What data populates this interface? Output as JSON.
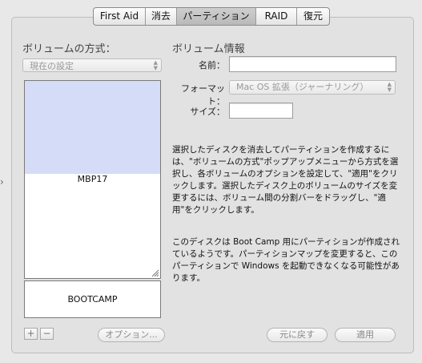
{
  "tabs": [
    "First Aid",
    "消去",
    "パーティション",
    "RAID",
    "復元"
  ],
  "active_tab": "パーティション",
  "left": {
    "heading": "ボリュームの方式：",
    "scheme_value": "現在の設定",
    "partitions": [
      {
        "name": "MBP17"
      },
      {
        "name": "BOOTCAMP"
      }
    ],
    "add_label": "+",
    "remove_label": "−",
    "options_label": "オプション..."
  },
  "right": {
    "heading": "ボリューム情報",
    "name_label": "名前：",
    "name_value": "",
    "format_label": "フォーマット：",
    "format_value": "Mac OS 拡張（ジャーナリング）",
    "size_label": "サイズ：",
    "size_value": "",
    "description1": "選択したディスクを消去してパーティションを作成するには、\"ボリュームの方式\"ポップアップメニューから方式を選択し、各ボリュームのオプションを設定して、\"適用\"をクリックします。選択したディスク上のボリュームのサイズを変更するには、ボリューム間の分割バーをドラッグし、\"適用\"をクリックします。",
    "description2": "このディスクは Boot Camp 用にパーティションが作成されているようです。パーティションマップを変更すると、このパーティションで Windows を起動できなくなる可能性があります。",
    "revert_label": "元に戻す",
    "apply_label": "適用"
  },
  "colors": {
    "selected_partition": "#d5dcf8",
    "window_bg": "#e8e8e8"
  }
}
